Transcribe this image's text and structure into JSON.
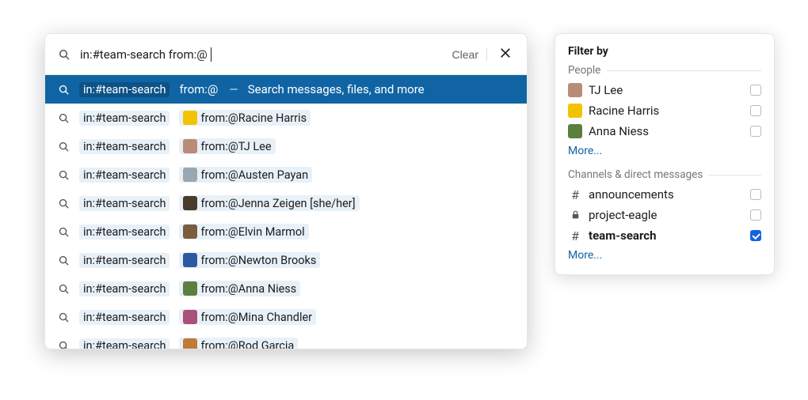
{
  "search": {
    "query_full": "in:#team-search from:@",
    "chip_channel": "in:#team-search",
    "from_prefix": "from:@",
    "clear_label": "Clear",
    "hint_sep": "—",
    "hint_text": "Search messages, files, and more"
  },
  "results": [
    {
      "chip": "in:#team-search",
      "from": "from:@",
      "hint": true,
      "avatar": null,
      "color": null,
      "name": ""
    },
    {
      "chip": "in:#team-search",
      "from": "from:@Racine Harris",
      "avatar": true,
      "color": "#f2c400",
      "name": "Racine Harris"
    },
    {
      "chip": "in:#team-search",
      "from": "from:@TJ Lee",
      "avatar": true,
      "color": "#b98c78",
      "name": "TJ Lee"
    },
    {
      "chip": "in:#team-search",
      "from": "from:@Austen Payan",
      "avatar": true,
      "color": "#9aa7b0",
      "name": "Austen Payan"
    },
    {
      "chip": "in:#team-search",
      "from": "from:@Jenna Zeigen [she/her]",
      "avatar": true,
      "color": "#4a3b2a",
      "name": "Jenna Zeigen"
    },
    {
      "chip": "in:#team-search",
      "from": "from:@Elvin Marmol",
      "avatar": true,
      "color": "#7a5c3e",
      "name": "Elvin Marmol"
    },
    {
      "chip": "in:#team-search",
      "from": "from:@Newton Brooks",
      "avatar": true,
      "color": "#2c5aa0",
      "name": "Newton Brooks"
    },
    {
      "chip": "in:#team-search",
      "from": "from:@Anna Niess",
      "avatar": true,
      "color": "#5b7f3f",
      "name": "Anna Niess"
    },
    {
      "chip": "in:#team-search",
      "from": "from:@Mina Chandler",
      "avatar": true,
      "color": "#a94f7b",
      "name": "Mina Chandler"
    },
    {
      "chip": "in:#team-search",
      "from": "from:@Rod Garcia",
      "avatar": true,
      "color": "#c07a3a",
      "name": "Rod Garcia"
    }
  ],
  "filter": {
    "title": "Filter by",
    "people_label": "People",
    "people": [
      {
        "name": "TJ Lee",
        "color": "#b98c78",
        "checked": false
      },
      {
        "name": "Racine Harris",
        "color": "#f2c400",
        "checked": false
      },
      {
        "name": "Anna Niess",
        "color": "#5b7f3f",
        "checked": false
      }
    ],
    "channels_label": "Channels & direct messages",
    "channels": [
      {
        "name": "announcements",
        "icon": "hash",
        "checked": false,
        "bold": false
      },
      {
        "name": "project-eagle",
        "icon": "lock",
        "checked": false,
        "bold": false
      },
      {
        "name": "team-search",
        "icon": "hash",
        "checked": true,
        "bold": true
      }
    ],
    "more_label": "More..."
  }
}
